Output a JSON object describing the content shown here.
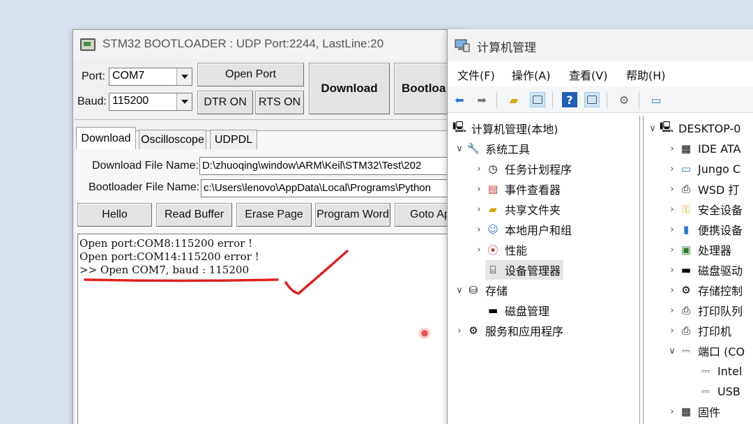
{
  "stm_window": {
    "title": "STM32 BOOTLOADER : UDP Port:2244, LastLine:20",
    "port_label": "Port:",
    "port_value": "COM7",
    "baud_label": "Baud:",
    "baud_value": "115200",
    "open_port_label": "Open Port",
    "dtr_label": "DTR ON",
    "rts_label": "RTS ON",
    "download_label": "Download",
    "bootloader_label": "Bootloa",
    "tabs": [
      "Download",
      "Oscilloscope",
      "UDPDL"
    ],
    "download_file_label": "Download File Name:",
    "download_file_value": "D:\\zhuoqing\\window\\ARM\\Keil\\STM32\\Test\\202",
    "bootloader_file_label": "Bootloader File Name:",
    "bootloader_file_value": "c:\\Users\\lenovo\\AppData\\Local\\Programs\\Python",
    "action_buttons": [
      "Hello",
      "Read Buffer",
      "Erase Page",
      "Program Word",
      "Goto Ap"
    ],
    "console_lines": [
      "Open port:COM8:115200 error !",
      "Open port:COM14:115200 error !",
      ">> Open COM7, baud : 115200"
    ],
    "annotation_color": "#e02020"
  },
  "cm_window": {
    "title": "计算机管理",
    "menu": [
      "文件(F)",
      "操作(A)",
      "查看(V)",
      "帮助(H)"
    ],
    "left_tree": [
      {
        "label": "计算机管理(本地)"
      },
      {
        "label": "系统工具"
      },
      {
        "label": "任务计划程序"
      },
      {
        "label": "事件查看器"
      },
      {
        "label": "共享文件夹"
      },
      {
        "label": "本地用户和组"
      },
      {
        "label": "性能"
      },
      {
        "label": "设备管理器"
      },
      {
        "label": "存储"
      },
      {
        "label": "磁盘管理"
      },
      {
        "label": "服务和应用程序"
      }
    ],
    "right_tree": [
      {
        "label": "DESKTOP-0"
      },
      {
        "label": "IDE ATA"
      },
      {
        "label": "Jungo C"
      },
      {
        "label": "WSD 打"
      },
      {
        "label": "安全设备"
      },
      {
        "label": "便携设备"
      },
      {
        "label": "处理器"
      },
      {
        "label": "磁盘驱动"
      },
      {
        "label": "存储控制"
      },
      {
        "label": "打印队列"
      },
      {
        "label": "打印机"
      },
      {
        "label": "端口 (CO"
      },
      {
        "label": "Intel"
      },
      {
        "label": "USB"
      },
      {
        "label": "固件"
      }
    ],
    "accent_color": "#2b79d0",
    "selected_bg": "#e5e5e5"
  }
}
